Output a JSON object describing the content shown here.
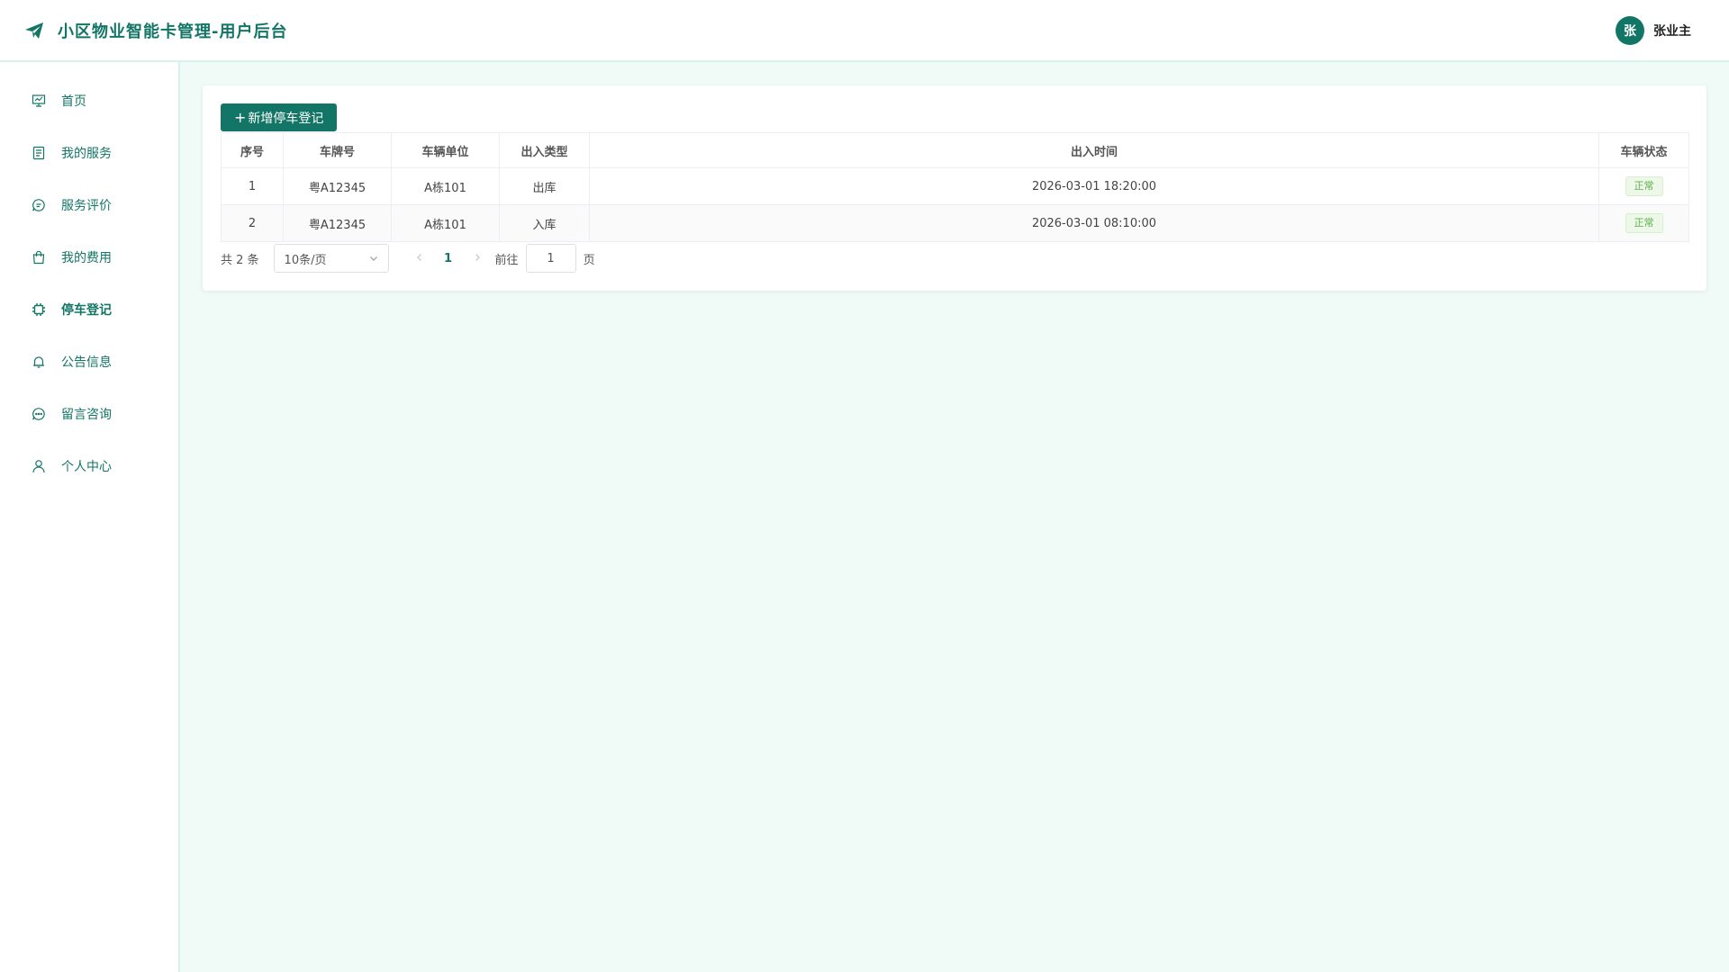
{
  "header": {
    "title": "小区物业智能卡管理-用户后台",
    "avatar_char": "张",
    "username": "张业主"
  },
  "sidebar": {
    "items": [
      {
        "label": "首页",
        "icon": "presentation-chart-icon"
      },
      {
        "label": "我的服务",
        "icon": "document-list-icon"
      },
      {
        "label": "服务评价",
        "icon": "chat-bubble-icon"
      },
      {
        "label": "我的费用",
        "icon": "shopping-bag-icon"
      },
      {
        "label": "停车登记",
        "icon": "chip-icon",
        "active": true
      },
      {
        "label": "公告信息",
        "icon": "bell-icon"
      },
      {
        "label": "留言咨询",
        "icon": "message-dots-icon"
      },
      {
        "label": "个人中心",
        "icon": "user-icon"
      }
    ]
  },
  "main": {
    "add_button": "新增停车登记",
    "table": {
      "headers": [
        "序号",
        "车牌号",
        "车辆单位",
        "出入类型",
        "出入时间",
        "车辆状态"
      ],
      "rows": [
        [
          "1",
          "粤A12345",
          "A栋101",
          "出库",
          "2026-03-01 18:20:00",
          "正常"
        ],
        [
          "2",
          "粤A12345",
          "A栋101",
          "入库",
          "2026-03-01 08:10:00",
          "正常"
        ]
      ]
    },
    "pagination": {
      "total": "共 2 条",
      "page_size": "10条/页",
      "current_page": "1",
      "goto_label": "前往",
      "goto_value": "1",
      "page_suffix": "页"
    }
  },
  "colors": {
    "accent": "#137566",
    "background": "#f0fbf8",
    "status_ok": "#5bb24a"
  }
}
